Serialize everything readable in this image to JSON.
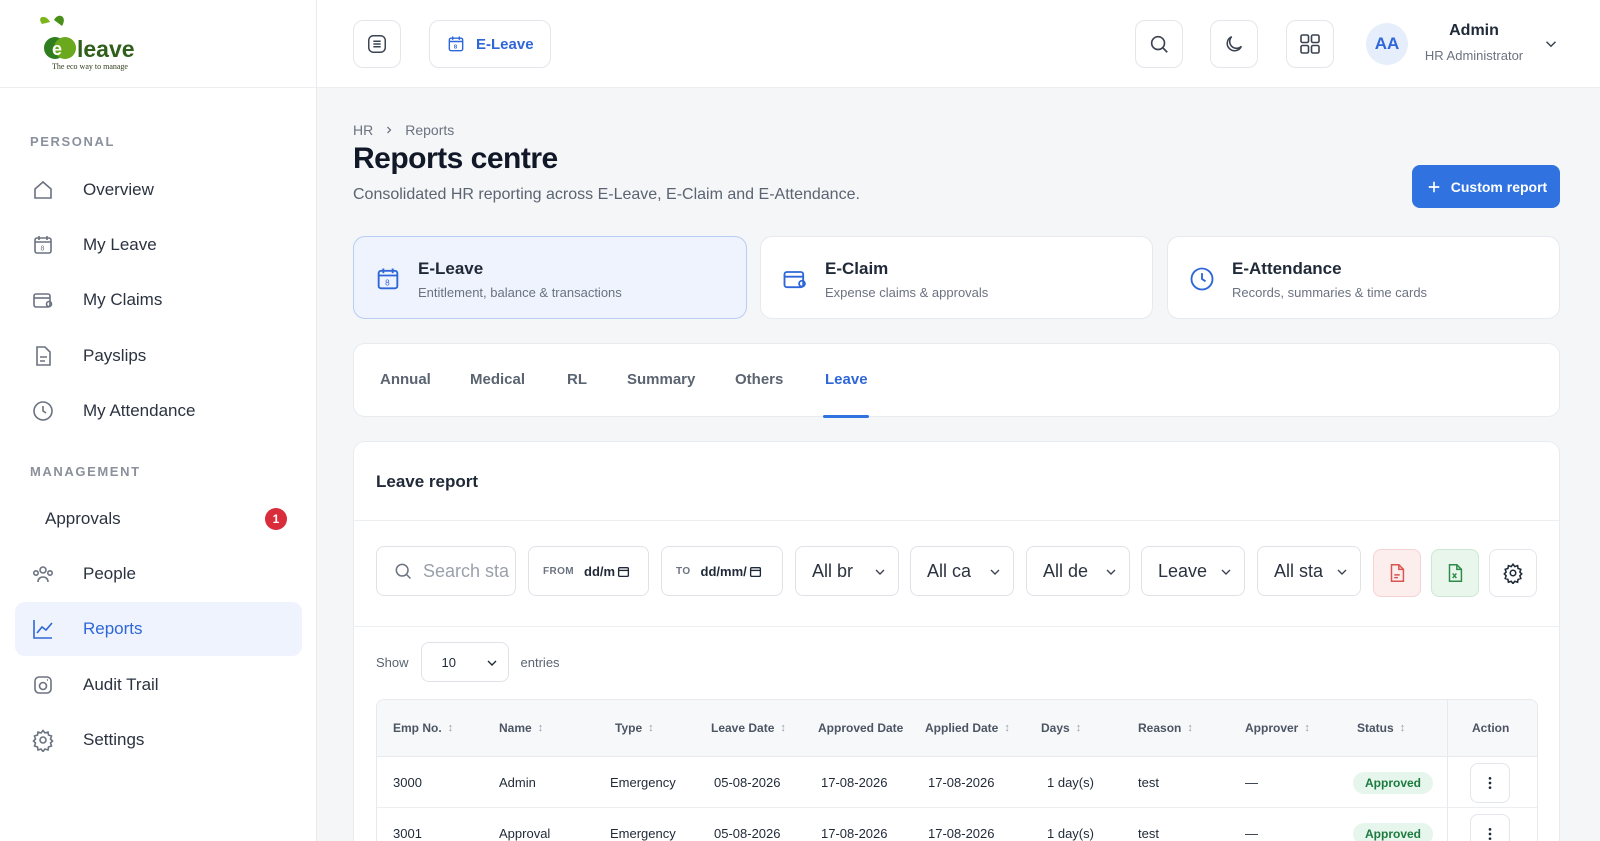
{
  "logo": {
    "text_main": "Ecoleave",
    "tagline": "The eco way to manage"
  },
  "sidebar": {
    "personal_label": "PERSONAL",
    "management_label": "MANAGEMENT",
    "items": [
      {
        "label": "Overview",
        "icon": "home-icon"
      },
      {
        "label": "My Leave",
        "icon": "calendar-icon"
      },
      {
        "label": "My Claims",
        "icon": "wallet-icon"
      },
      {
        "label": "Payslips",
        "icon": "document-icon"
      },
      {
        "label": "My Attendance",
        "icon": "clock-icon"
      },
      {
        "label": "Approvals",
        "badge": "1"
      },
      {
        "label": "People",
        "icon": "people-icon"
      },
      {
        "label": "Reports",
        "icon": "chart-icon",
        "active": true
      },
      {
        "label": "Audit Trail",
        "icon": "audit-icon"
      },
      {
        "label": "Settings",
        "icon": "gear-icon"
      }
    ]
  },
  "topbar": {
    "module": "E-Leave",
    "user": {
      "initials": "AA",
      "name": "Admin",
      "role": "HR Administrator"
    }
  },
  "breadcrumb": {
    "root": "HR",
    "current": "Reports"
  },
  "page": {
    "title": "Reports centre",
    "subtitle": "Consolidated HR reporting across E-Leave, E-Claim and E-Attendance.",
    "custom_report_label": "Custom report"
  },
  "modules": [
    {
      "title": "E-Leave",
      "sub": "Entitlement, balance & transactions"
    },
    {
      "title": "E-Claim",
      "sub": "Expense claims & approvals"
    },
    {
      "title": "E-Attendance",
      "sub": "Records, summaries & time cards"
    }
  ],
  "tabs": [
    "Annual",
    "Medical",
    "RL",
    "Summary",
    "Others",
    "Leave"
  ],
  "report": {
    "title": "Leave report",
    "search_placeholder": "Search sta",
    "from_label": "FROM",
    "from_value": "dd/m",
    "to_label": "TO",
    "to_value": "dd/mm/",
    "selects": [
      "All br",
      "All ca",
      "All de",
      "Leave",
      "All sta"
    ],
    "show_label": "Show",
    "entries_value": "10",
    "entries_label": "entries"
  },
  "table": {
    "headers": [
      "Emp No.",
      "Name",
      "Type",
      "Leave Date",
      "Approved Date",
      "Applied Date",
      "Days",
      "Reason",
      "Approver",
      "Status",
      "Action"
    ],
    "rows": [
      {
        "emp": "3000",
        "name": "Admin",
        "type": "Emergency",
        "leave_date": "05-08-2026",
        "approved": "17-08-2026",
        "applied": "17-08-2026",
        "days": "1 day(s)",
        "reason": "test",
        "approver": "—",
        "status": "Approved"
      },
      {
        "emp": "3001",
        "name": "Approval",
        "type": "Emergency",
        "leave_date": "05-08-2026",
        "approved": "17-08-2026",
        "applied": "17-08-2026",
        "days": "1 day(s)",
        "reason": "test",
        "approver": "—",
        "status": "Approved"
      }
    ]
  },
  "colors": {
    "accent": "#2f72e0",
    "active_bg": "#eef3fd",
    "danger": "#d92d3c",
    "success_bg": "#e7f6ec",
    "success_fg": "#1d7a3f"
  }
}
